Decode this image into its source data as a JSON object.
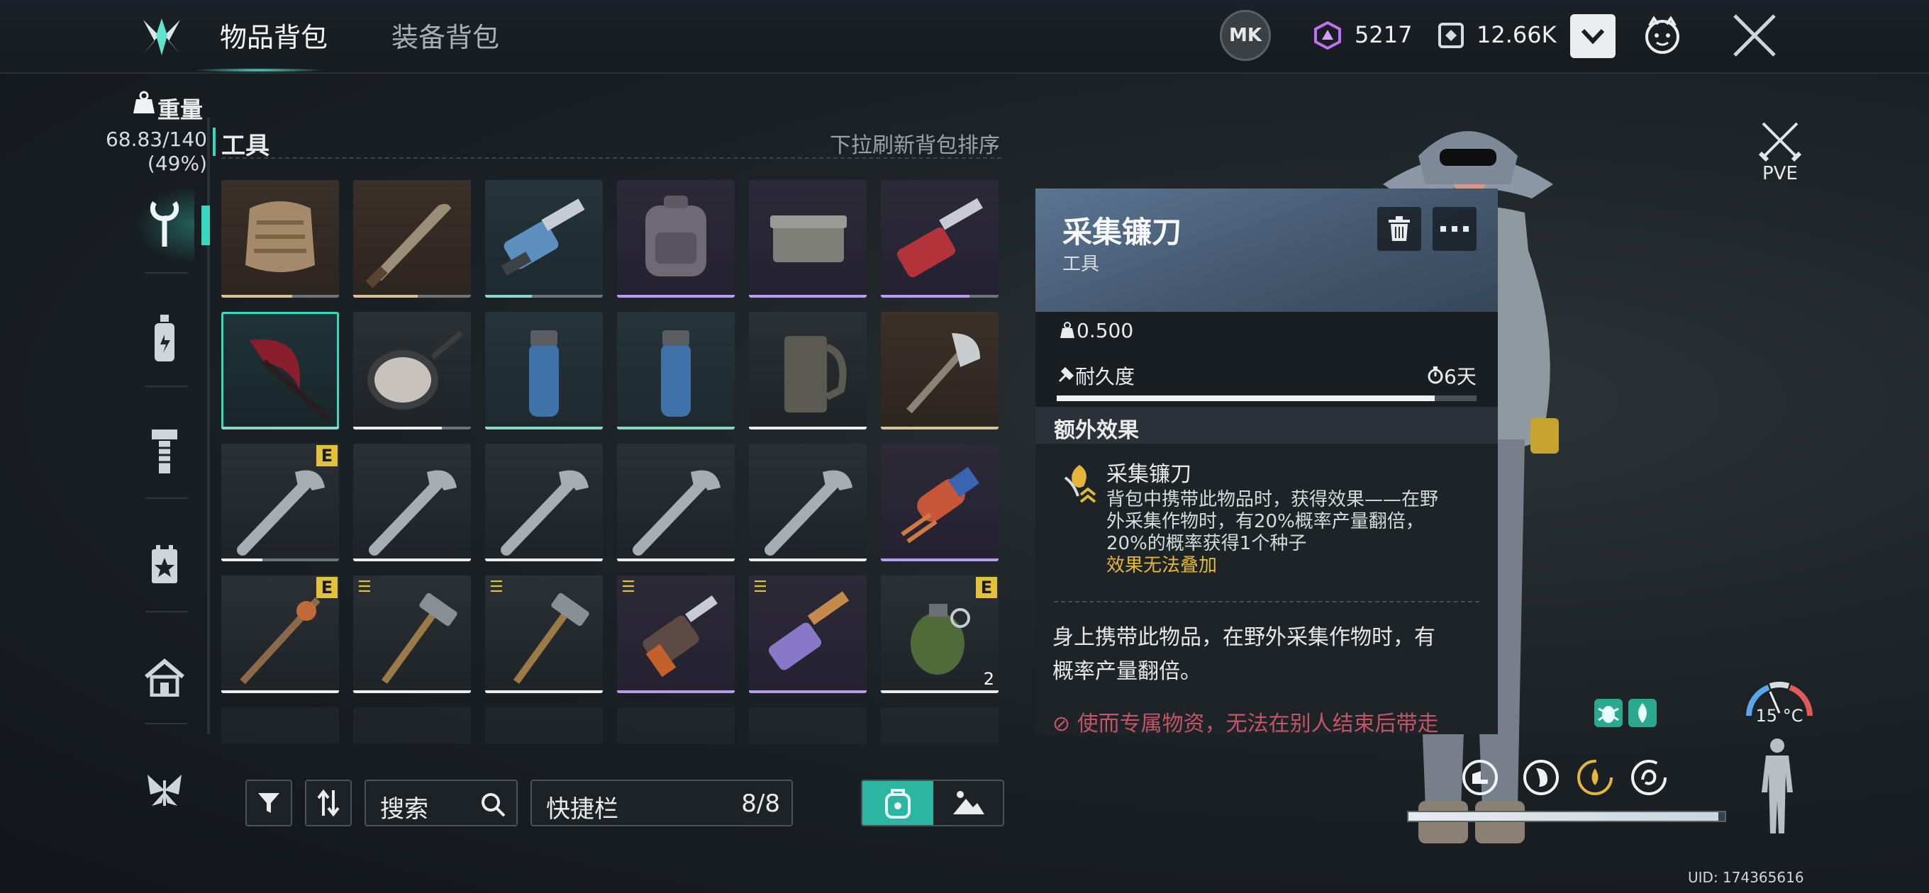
{
  "header": {
    "tabs": [
      {
        "label": "物品背包",
        "active": true
      },
      {
        "label": "装备背包",
        "active": false
      }
    ],
    "currency_a": "5217",
    "currency_b": "12.66K",
    "mk_badge": "MK"
  },
  "weight": {
    "label": "重量",
    "value": "68.83/140",
    "percent": "(49%)"
  },
  "inventory": {
    "category": "工具",
    "refresh_hint": "下拉刷新背包排序",
    "slots": [
      {
        "icon": "ghillie-vest-icon",
        "rarity": "brown",
        "durability": 0.6
      },
      {
        "icon": "machete-icon",
        "rarity": "brown",
        "durability": 0.55
      },
      {
        "icon": "chainsaw-icon",
        "rarity": "teal",
        "durability": 0.4
      },
      {
        "icon": "backpack-icon",
        "rarity": "purple",
        "durability": 1.0
      },
      {
        "icon": "ammo-box-icon",
        "rarity": "purple",
        "durability": 1.0
      },
      {
        "icon": "chainsaw-red-icon",
        "rarity": "purple",
        "durability": 0.75
      },
      {
        "icon": "harvest-sickle-icon",
        "rarity": "teal",
        "durability": 1.0,
        "selected": true
      },
      {
        "icon": "frying-pan-icon",
        "rarity": "plain",
        "durability": 0.75
      },
      {
        "icon": "blue-bottle-icon",
        "rarity": "teal",
        "durability": 1.0
      },
      {
        "icon": "blue-bottle-icon",
        "rarity": "teal",
        "durability": 1.0
      },
      {
        "icon": "metal-jug-icon",
        "rarity": "plain",
        "durability": 1.0
      },
      {
        "icon": "hatchet-icon",
        "rarity": "brown",
        "durability": 1.0
      },
      {
        "icon": "wrench-icon",
        "rarity": "plain",
        "durability": 0.35,
        "badge": "E"
      },
      {
        "icon": "wrench-icon",
        "rarity": "plain",
        "durability": 1.0
      },
      {
        "icon": "wrench-icon",
        "rarity": "plain",
        "durability": 1.0
      },
      {
        "icon": "wrench-icon",
        "rarity": "plain",
        "durability": 1.0
      },
      {
        "icon": "wrench-icon",
        "rarity": "plain",
        "durability": 1.0
      },
      {
        "icon": "ray-gun-icon",
        "rarity": "purple",
        "durability": 1.0
      },
      {
        "icon": "torch-icon",
        "rarity": "plain",
        "durability": 1.0,
        "badge": "E"
      },
      {
        "icon": "hammer-icon",
        "rarity": "plain",
        "durability": 1.0,
        "mark": "z"
      },
      {
        "icon": "hammer-icon",
        "rarity": "plain",
        "durability": 1.0,
        "mark": "z"
      },
      {
        "icon": "drill-icon",
        "rarity": "purple",
        "durability": 1.0,
        "mark": "z"
      },
      {
        "icon": "chainsaw-purple-icon",
        "rarity": "purple",
        "durability": 1.0,
        "mark": "z"
      },
      {
        "icon": "grenade-icon",
        "rarity": "plain",
        "durability": 1.0,
        "badge": "E",
        "qty": "2"
      }
    ]
  },
  "toolbar": {
    "search_placeholder": "搜索",
    "quickbar_label": "快捷栏",
    "quickbar_count": "8/8"
  },
  "detail": {
    "name": "采集镰刀",
    "type": "工具",
    "weight": "0.500",
    "durability_label": "耐久度",
    "durability_time": "6天",
    "durability_level": 0.9,
    "extra_effect_title": "额外效果",
    "effect_name": "采集镰刀",
    "effect_desc_1": "背包中携带此物品时，获得效果——在野",
    "effect_desc_2": "外采集作物时，有20%概率产量翻倍，",
    "effect_desc_3": "20%的概率获得1个种子",
    "effect_note": "效果无法叠加",
    "description_1": "身上携带此物品，在野外采集作物时，有",
    "description_2": "概率产量翻倍。",
    "warning": "使而专属物资，无法在别人结束后带走"
  },
  "side": {
    "mode_label": "PVE",
    "temperature": "15 °C",
    "uid": "UID: 174365616",
    "status_level": 0.98
  },
  "colors": {
    "accent": "#38d8c0",
    "gold": "#e3b63c",
    "purple_bar": "#b89cf0",
    "brown_bar": "#d8c29a",
    "teal_bar": "#8fd6c8"
  }
}
